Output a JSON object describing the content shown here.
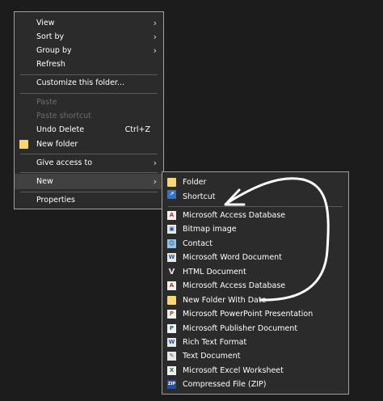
{
  "main_menu": {
    "view": "View",
    "sort_by": "Sort by",
    "group_by": "Group by",
    "refresh": "Refresh",
    "customize": "Customize this folder...",
    "paste": "Paste",
    "paste_shortcut": "Paste shortcut",
    "undo_delete": "Undo Delete",
    "undo_shortcut": "Ctrl+Z",
    "new_folder": "New folder",
    "give_access": "Give access to",
    "new": "New",
    "properties": "Properties",
    "chevron": "›"
  },
  "sub_menu": {
    "folder": "Folder",
    "shortcut": "Shortcut",
    "access_db": "Microsoft Access Database",
    "bitmap": "Bitmap image",
    "contact": "Contact",
    "word": "Microsoft Word Document",
    "html": "HTML Document",
    "access_db_2": "Microsoft Access Database",
    "new_folder_date": "New Folder With Date",
    "powerpoint": "Microsoft PowerPoint Presentation",
    "publisher": "Microsoft Publisher Document",
    "rtf": "Rich Text Format",
    "text": "Text Document",
    "excel": "Microsoft Excel Worksheet",
    "zip": "Compressed File (ZIP)"
  },
  "icons": {
    "access": "A",
    "bitmap": "▣",
    "contact": "☺",
    "word": "W",
    "html": "V",
    "ppt": "P",
    "pub": "P",
    "rtf": "W",
    "txt": "✎",
    "xls": "X",
    "zip": "ZIP",
    "shortcut": "↗"
  },
  "colors": {
    "menu_bg": "#2b2b2b",
    "highlight": "#414141",
    "border": "#a0a0a0",
    "annotation": "#ffffff"
  }
}
